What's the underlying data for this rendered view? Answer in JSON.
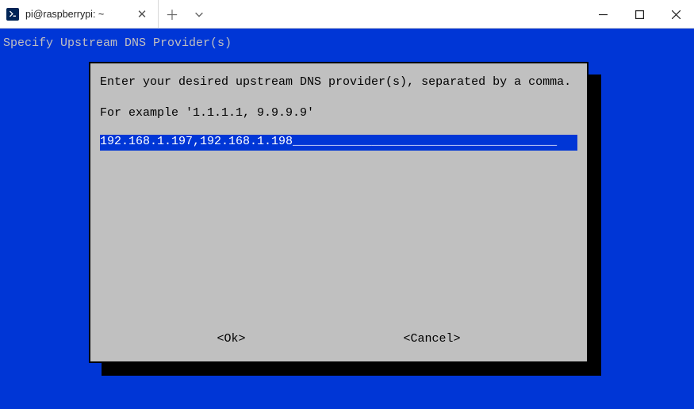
{
  "window": {
    "tab_title": "pi@raspberrypi: ~"
  },
  "tui": {
    "title": "Specify Upstream DNS Provider(s)",
    "line1": "Enter your desired upstream DNS provider(s), separated by a comma.",
    "line2": "For example '1.1.1.1, 9.9.9.9'",
    "input_value": "192.168.1.197,192.168.1.198",
    "input_fill": "_____________________________________",
    "ok_label": "<Ok>",
    "cancel_label": "<Cancel>"
  }
}
